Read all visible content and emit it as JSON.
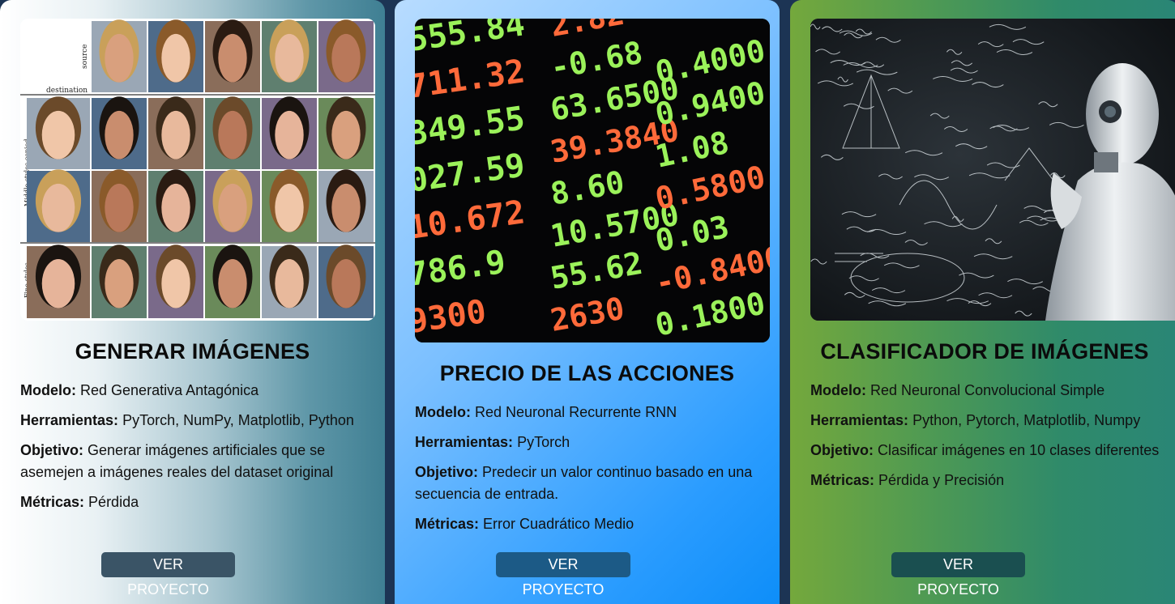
{
  "cards": [
    {
      "image_alt": "StyleGAN face grid",
      "image_labels": {
        "source": "source",
        "destination": "destination",
        "middle": "Middle styles copied",
        "fine": "Fine styles"
      },
      "title": "GENERAR IMÁGENES",
      "model_label": "Modelo:",
      "model_value": "Red Generativa Antagónica",
      "tools_label": "Herramientas:",
      "tools_value": "PyTorch, NumPy, Matplotlib, Python",
      "goal_label": "Objetivo:",
      "goal_value": "Generar imágenes artificiales que se asemejen a imágenes reales del dataset original",
      "metrics_label": "Métricas:",
      "metrics_value": "Pérdida",
      "button_label": "VER PROYECTO"
    },
    {
      "image_alt": "Stock ticker board",
      "ticker_left": [
        "555.84",
        "711.32",
        "349.55",
        "027.59",
        "10.672",
        "786.9",
        "9300"
      ],
      "ticker_mid": [
        "2.82",
        "-0.68",
        "63.6500",
        "39.3840",
        "8.60",
        "10.5700",
        "55.62",
        "2630"
      ],
      "ticker_right": [
        "0.4000",
        "0.9400",
        "1.08",
        "0.5800",
        "0.03",
        "-0.8400",
        "0.1800"
      ],
      "title": "PRECIO DE LAS ACCIONES",
      "model_label": "Modelo:",
      "model_value": "Red Neuronal Recurrente RNN",
      "tools_label": "Herramientas:",
      "tools_value": "PyTorch",
      "goal_label": "Objetivo:",
      "goal_value": "Predecir un valor continuo basado en una secuencia de entrada.",
      "metrics_label": "Métricas:",
      "metrics_value": "Error Cuadrático Medio",
      "button_label": "VER PROYECTO"
    },
    {
      "image_alt": "Robot in front of math chalkboard",
      "title": "CLASIFICADOR DE IMÁGENES",
      "model_label": "Modelo:",
      "model_value": "Red Neuronal Convolucional Simple",
      "tools_label": "Herramientas:",
      "tools_value": "Python, Pytorch, Matplotlib, Numpy",
      "goal_label": "Objetivo:",
      "goal_value": "Clasificar imágenes en 10 clases diferentes",
      "metrics_label": "Métricas:",
      "metrics_value": "Pérdida y Precisión",
      "button_label": "VER PROYECTO"
    }
  ],
  "colors": {
    "page_bg": "#1c3454",
    "ticker_green": "#9bf25a",
    "ticker_red": "#ff6a3a"
  }
}
